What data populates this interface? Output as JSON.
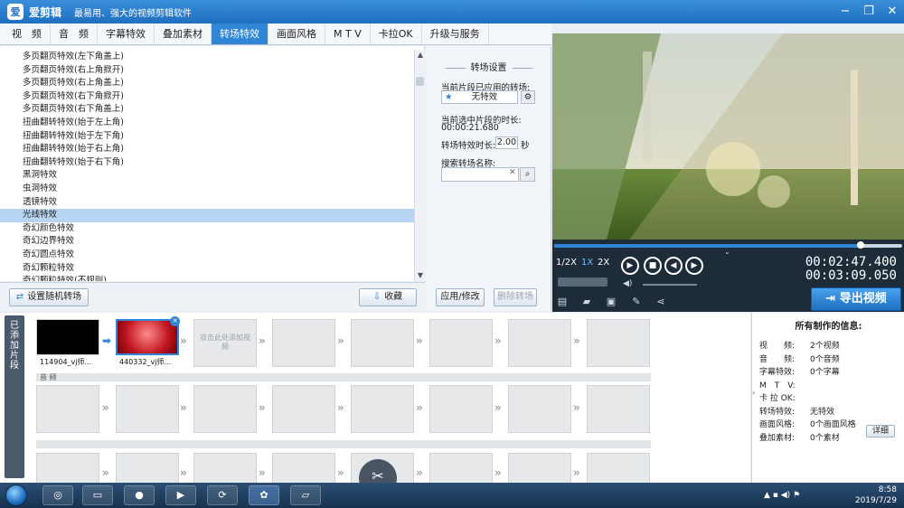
{
  "app": {
    "name": "爱剪辑",
    "slogan": "最易用、强大的视频剪辑软件",
    "logo_text": "爱"
  },
  "window_controls": {
    "minimize": "−",
    "restore": "❐",
    "close": "✕"
  },
  "tabs": [
    {
      "label": "视　频",
      "active": false
    },
    {
      "label": "音　频",
      "active": false
    },
    {
      "label": "字幕特效",
      "active": false
    },
    {
      "label": "叠加素材",
      "active": false
    },
    {
      "label": "转场特效",
      "active": true
    },
    {
      "label": "画面风格",
      "active": false
    },
    {
      "label": "M T V",
      "active": false
    },
    {
      "label": "卡拉OK",
      "active": false
    },
    {
      "label": "升级与服务",
      "active": false
    }
  ],
  "transition_list": {
    "selected_index": 12,
    "items": [
      "多页翻页特效(左下角盖上)",
      "多页翻页特效(右上角掀开)",
      "多页翻页特效(右上角盖上)",
      "多页翻页特效(右下角掀开)",
      "多页翻页特效(右下角盖上)",
      "扭曲翻转特效(始于左上角)",
      "扭曲翻转特效(始于左下角)",
      "扭曲翻转特效(始于右上角)",
      "扭曲翻转特效(始于右下角)",
      "黑洞特效",
      "虫洞特效",
      "透镜特效",
      "光线特效",
      "奇幻颜色特效",
      "奇幻边界特效",
      "奇幻圆点特效",
      "奇幻颗粒特效",
      "奇幻颗粒特效(不规则)"
    ]
  },
  "left_buttons": {
    "random": "设置随机转场",
    "favorite": "收藏"
  },
  "settings": {
    "title": "转场设置",
    "current_label": "当前片段已应用的转场:",
    "current_value": "无特效",
    "duration_label": "当前选中片段的时长:",
    "duration_value": "00:00:21.680",
    "effect_duration_label": "转场特效时长:",
    "effect_duration_value": "2.00",
    "effect_duration_unit": "秒",
    "search_label": "搜索转场名称:",
    "search_value": "",
    "apply_button": "应用/修改",
    "delete_button": "删除转场"
  },
  "player": {
    "progress_fraction": 0.88,
    "speeds": [
      "1/2X",
      "1X",
      "2X"
    ],
    "active_speed": "1X",
    "current_time": "00:02:47.400",
    "total_time": "00:03:09.050",
    "export_label": "导出视频"
  },
  "timeline": {
    "side_label": "已添加片段",
    "clips": [
      {
        "label": "114904_vj师..."
      },
      {
        "label": "440332_vj师..."
      }
    ],
    "empty_slot_hint": "双击此处添加视频",
    "audio_track_label": "音 频"
  },
  "info": {
    "title": "所有制作的信息:",
    "rows": [
      {
        "key": "视　　频:",
        "value": "2个视频"
      },
      {
        "key": "音　　频:",
        "value": "0个音频"
      },
      {
        "key": "字幕特效:",
        "value": "0个字幕"
      },
      {
        "key": "M　T　V:",
        "value": ""
      },
      {
        "key": "卡 拉 OK:",
        "value": ""
      },
      {
        "key": "转场特效:",
        "value": "无特效"
      },
      {
        "key": "画面风格:",
        "value": "0个画面风格"
      },
      {
        "key": "叠加素材:",
        "value": "0个素材"
      }
    ],
    "detail_button": "详细"
  },
  "taskbar": {
    "time": "8:58",
    "date": "2019/7/29"
  },
  "colors": {
    "accent": "#2f86d6",
    "selected_row": "#b7d4f2",
    "dark_panel": "#1e2c3a"
  }
}
